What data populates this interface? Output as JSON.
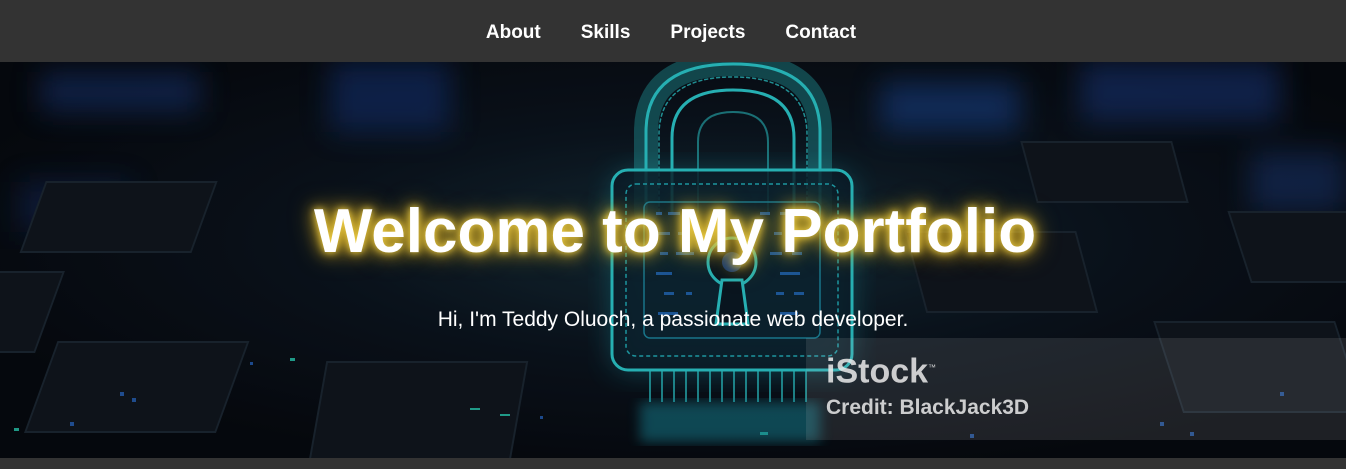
{
  "nav": {
    "items": [
      {
        "label": "About"
      },
      {
        "label": "Skills"
      },
      {
        "label": "Projects"
      },
      {
        "label": "Contact"
      }
    ]
  },
  "hero": {
    "title": "Welcome to My Portfolio",
    "subtitle": "Hi, I'm Teddy Oluoch, a passionate web developer.",
    "background_image": "padlock-circuit-icon",
    "watermark": {
      "logo": "iStock",
      "trademark": "™",
      "credit": "Credit: BlackJack3D"
    }
  },
  "colors": {
    "navbar_bg": "#333333",
    "nav_text": "#ffffff",
    "title_glow": "#f5d54a",
    "lock_accent": "#2ee6e0",
    "circuit_blue": "#1a5fd0"
  }
}
